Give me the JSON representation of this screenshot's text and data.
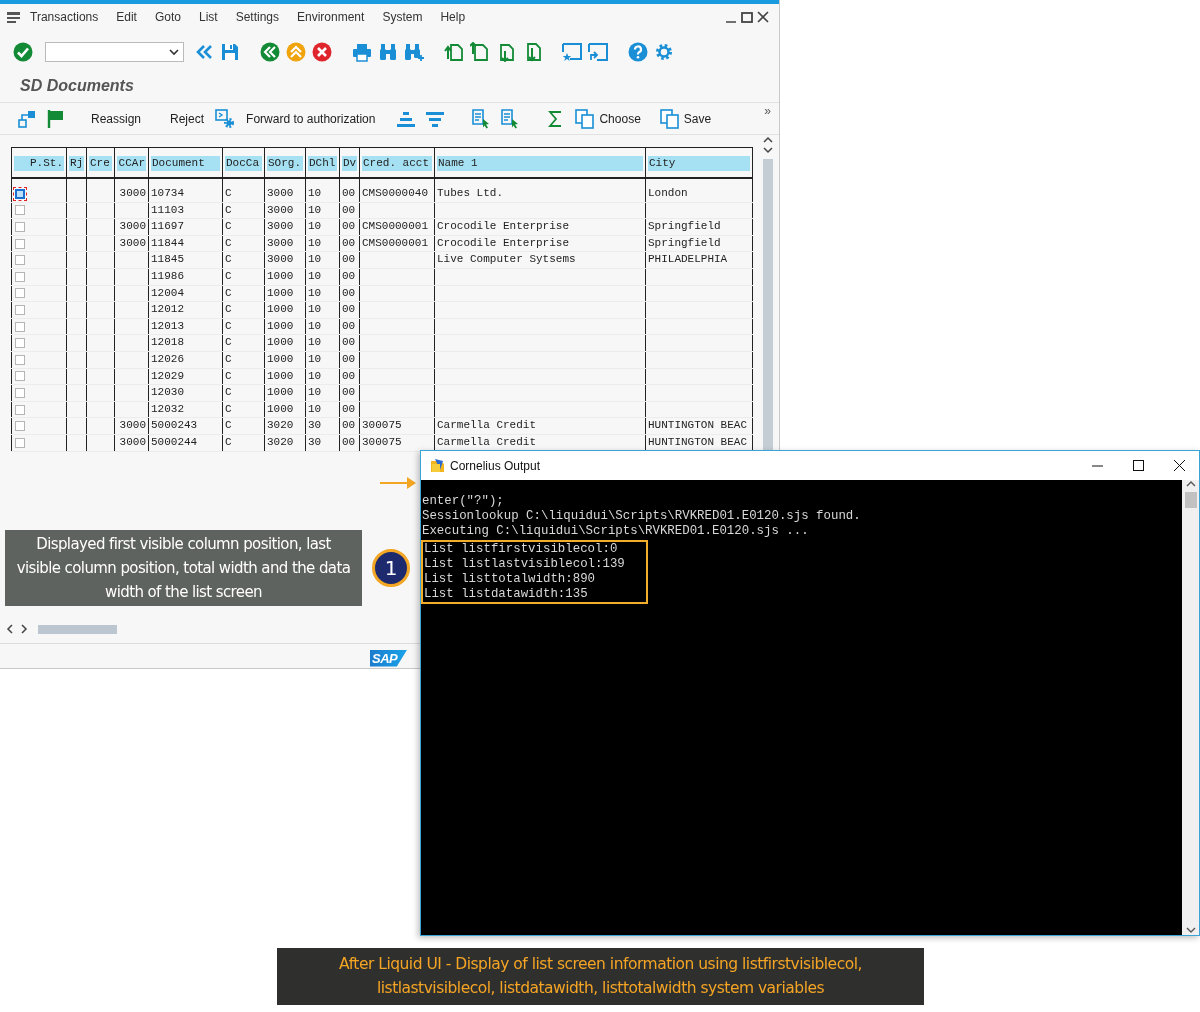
{
  "sap_window": {
    "menu": [
      "Transactions",
      "Edit",
      "Goto",
      "List",
      "Settings",
      "Environment",
      "System",
      "Help"
    ],
    "screen_title": "SD Documents",
    "app_toolbar": [
      "Reassign",
      "Reject",
      "Forward to authorization",
      "Choose",
      "Save"
    ],
    "overflow_button": "»",
    "table": {
      "columns": [
        {
          "label": "P.St."
        },
        {
          "label": "Rj"
        },
        {
          "label": "Cre"
        },
        {
          "label": "CCAr"
        },
        {
          "label": "Document"
        },
        {
          "label": "DocCa"
        },
        {
          "label": "SOrg."
        },
        {
          "label": "DChl"
        },
        {
          "label": "Dv"
        },
        {
          "label": "Cred. acct"
        },
        {
          "label": "Name 1"
        },
        {
          "label": "City"
        }
      ],
      "rows": [
        {
          "focused": true,
          "ccar": "3000",
          "document": "10734",
          "docca": "C",
          "sorg": "3000",
          "dchl": "10",
          "dv": "00",
          "cred_acct": "CMS0000040",
          "name_1": "Tubes Ltd.",
          "city": "London"
        },
        {
          "focused": false,
          "document": "11103",
          "docca": "C",
          "sorg": "3000",
          "dchl": "10",
          "dv": "00"
        },
        {
          "focused": false,
          "ccar": "3000",
          "document": "11697",
          "docca": "C",
          "sorg": "3000",
          "dchl": "10",
          "dv": "00",
          "cred_acct": "CMS0000001",
          "name_1": "Crocodile Enterprise",
          "city": "Springfield"
        },
        {
          "focused": false,
          "ccar": "3000",
          "document": "11844",
          "docca": "C",
          "sorg": "3000",
          "dchl": "10",
          "dv": "00",
          "cred_acct": "CMS0000001",
          "name_1": "Crocodile Enterprise",
          "city": "Springfield"
        },
        {
          "focused": false,
          "document": "11845",
          "docca": "C",
          "sorg": "3000",
          "dchl": "10",
          "dv": "00",
          "name_1": "Live Computer Sytsems",
          "city": "PHILADELPHIA"
        },
        {
          "focused": false,
          "document": "11986",
          "docca": "C",
          "sorg": "1000",
          "dchl": "10",
          "dv": "00"
        },
        {
          "focused": false,
          "document": "12004",
          "docca": "C",
          "sorg": "1000",
          "dchl": "10",
          "dv": "00"
        },
        {
          "focused": false,
          "document": "12012",
          "docca": "C",
          "sorg": "1000",
          "dchl": "10",
          "dv": "00"
        },
        {
          "focused": false,
          "document": "12013",
          "docca": "C",
          "sorg": "1000",
          "dchl": "10",
          "dv": "00"
        },
        {
          "focused": false,
          "document": "12018",
          "docca": "C",
          "sorg": "1000",
          "dchl": "10",
          "dv": "00"
        },
        {
          "focused": false,
          "document": "12026",
          "docca": "C",
          "sorg": "1000",
          "dchl": "10",
          "dv": "00"
        },
        {
          "focused": false,
          "document": "12029",
          "docca": "C",
          "sorg": "1000",
          "dchl": "10",
          "dv": "00"
        },
        {
          "focused": false,
          "document": "12030",
          "docca": "C",
          "sorg": "1000",
          "dchl": "10",
          "dv": "00"
        },
        {
          "focused": false,
          "document": "12032",
          "docca": "C",
          "sorg": "1000",
          "dchl": "10",
          "dv": "00"
        },
        {
          "focused": false,
          "ccar": "3000",
          "document": "5000243",
          "docca": "C",
          "sorg": "3020",
          "dchl": "30",
          "dv": "00",
          "cred_acct": "300075",
          "name_1": "Carmella Credit",
          "city": "HUNTINGTON BEAC"
        },
        {
          "focused": false,
          "ccar": "3000",
          "document": "5000244",
          "docca": "C",
          "sorg": "3020",
          "dchl": "30",
          "dv": "00",
          "cred_acct": "300075",
          "name_1": "Carmella Credit",
          "city": "HUNTINGTON BEAC"
        }
      ]
    },
    "logo": "SAP"
  },
  "console_window": {
    "title": "Cornelius Output",
    "lines": [
      {
        "text": "enter(\"?\");",
        "highlighted": false
      },
      {
        "text": "Sessionlookup C:\\liquidui\\Scripts\\RVKRED01.E0120.sjs found.",
        "highlighted": false
      },
      {
        "text": "Executing C:\\liquidui\\Scripts\\RVKRED01.E0120.sjs ...",
        "highlighted": false
      },
      {
        "text": "List listfirstvisiblecol:0",
        "highlighted": true
      },
      {
        "text": "List listlastvisiblecol:139",
        "highlighted": true
      },
      {
        "text": "List listtotalwidth:890",
        "highlighted": true
      },
      {
        "text": "List listdatawidth:135",
        "highlighted": true
      }
    ]
  },
  "callout": {
    "text": "Displayed first visible column position, last visible column position, total width and the data width of the list screen",
    "badge": "1"
  },
  "caption": "After Liquid UI - Display of list screen information using listfirstvisiblecol, listlastvisiblecol, listdatawidth, listtotalwidth system variables"
}
